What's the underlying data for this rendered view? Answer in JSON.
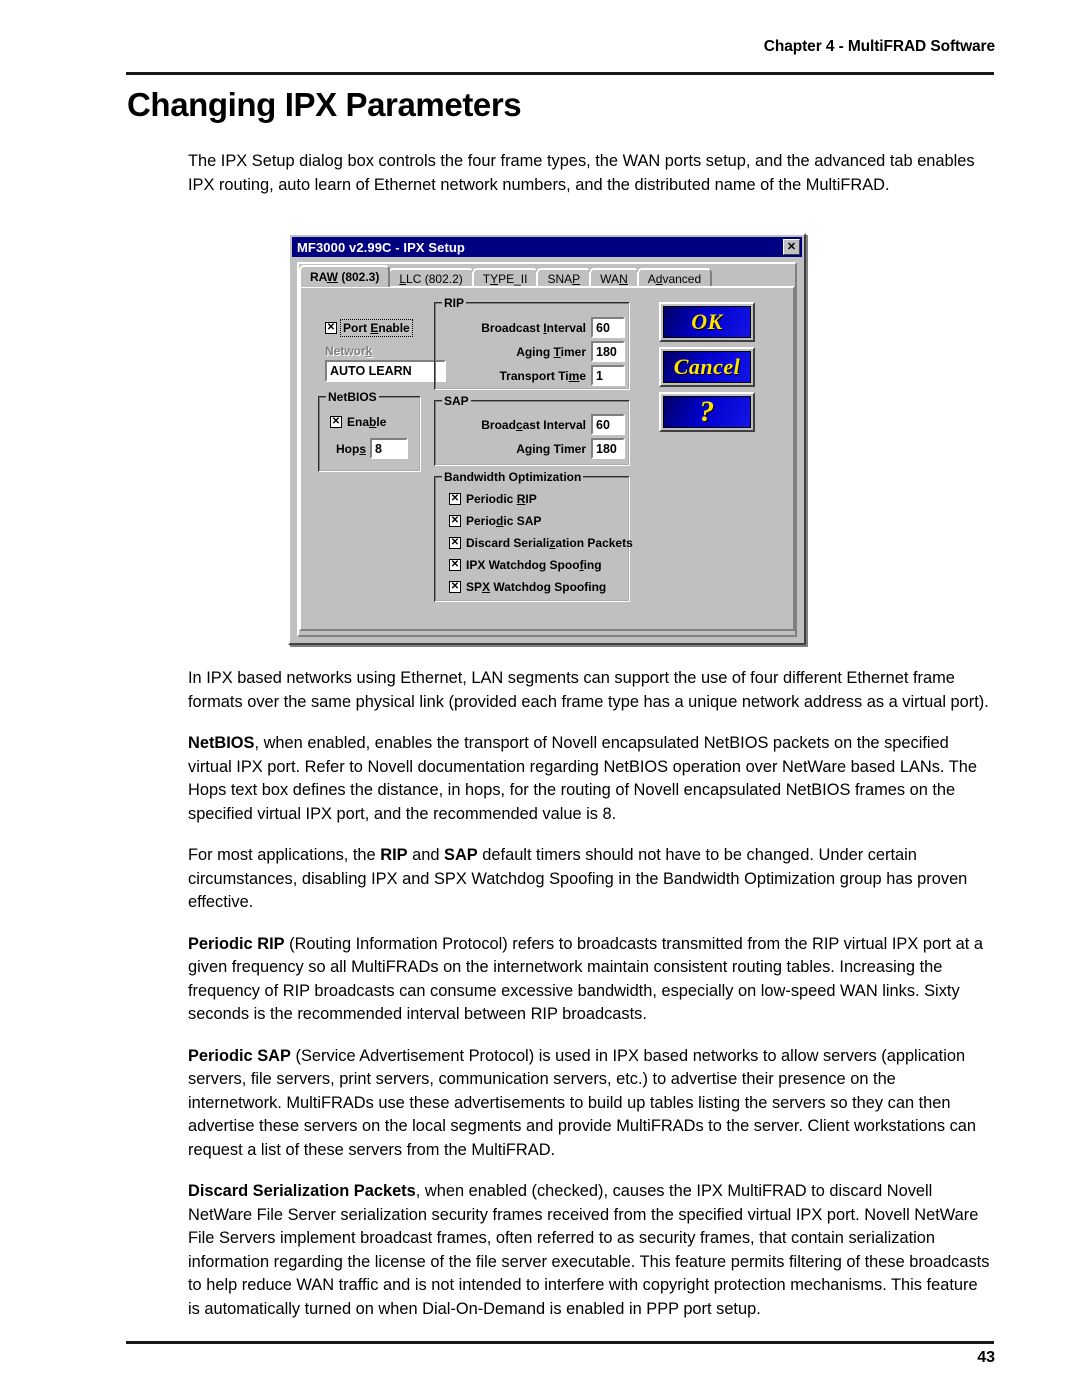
{
  "page": {
    "running_head": "Chapter 4 - MultiFRAD Software",
    "title": "Changing IPX Parameters",
    "folio": "43"
  },
  "intro": {
    "paragraph": "The IPX Setup dialog box controls the four frame types, the WAN ports setup, and the advanced tab enables IPX routing, auto learn of Ethernet network numbers, and the distributed name of the MultiFRAD."
  },
  "dialog": {
    "title": "MF3000 v2.99C - IPX Setup",
    "close_label": "✕",
    "tabs": [
      {
        "label": "RAW (802.3)",
        "pre": "RA",
        "accel": "W",
        "post": " (802.3)",
        "active": true
      },
      {
        "label": "LLC (802.2)",
        "pre": "",
        "accel": "L",
        "post": "LC (802.2)",
        "active": false
      },
      {
        "label": "TYPE_II",
        "pre": "T",
        "accel": "Y",
        "post": "PE_II",
        "active": false
      },
      {
        "label": "SNAP",
        "pre": "SNA",
        "accel": "P",
        "post": "",
        "active": false
      },
      {
        "label": "WAN",
        "pre": "WA",
        "accel": "N",
        "post": "",
        "active": false
      },
      {
        "label": "Advanced",
        "pre": "A",
        "accel": "d",
        "post": "vanced",
        "active": false
      }
    ],
    "port_enable": {
      "label_pre": "Port ",
      "accel": "E",
      "label_post": "nable",
      "checked": "X"
    },
    "network": {
      "label_pre": "Networ",
      "accel": "k",
      "label_post": "",
      "value": "AUTO LEARN"
    },
    "netbios": {
      "group_title": "NetBIOS",
      "enable": {
        "label_pre": "Ena",
        "accel": "b",
        "label_post": "le",
        "checked": "X"
      },
      "hops": {
        "label_pre": "Hop",
        "accel": "s",
        "label_post": "",
        "value": "8"
      }
    },
    "rip": {
      "group_title": "RIP",
      "rows": [
        {
          "label_pre": "Broadcast ",
          "accel": "I",
          "label_post": "nterval",
          "value": "60"
        },
        {
          "label_pre": "Aging ",
          "accel": "T",
          "label_post": "imer",
          "value": "180"
        },
        {
          "label_pre": "Transport Ti",
          "accel": "m",
          "label_post": "e",
          "value": "1"
        }
      ]
    },
    "sap": {
      "group_title": "SAP",
      "rows": [
        {
          "label_pre": "Broad",
          "accel": "c",
          "label_post": "ast Interval",
          "value": "60"
        },
        {
          "label_pre": "A",
          "accel": "g",
          "label_post": "ing Timer",
          "value": "180"
        }
      ]
    },
    "bandwidth": {
      "group_title": "Bandwidth Optimization",
      "items": [
        {
          "label_pre": "Periodic ",
          "accel": "R",
          "label_post": "IP",
          "checked": "X"
        },
        {
          "label_pre": "Perio",
          "accel": "d",
          "label_post": "ic SAP",
          "checked": "X"
        },
        {
          "label_pre": "Discard Seriali",
          "accel": "z",
          "label_post": "ation Packets",
          "checked": "X"
        },
        {
          "label_pre": "IPX Watchdog Spoo",
          "accel": "f",
          "label_post": "ing",
          "checked": "X"
        },
        {
          "label_pre": "SP",
          "accel": "X",
          "label_post": " Watchdog Spoofing",
          "checked": "X"
        }
      ]
    },
    "buttons": {
      "ok": "OK",
      "cancel": "Cancel",
      "help": "?"
    }
  },
  "body": {
    "p1": "In IPX based networks using Ethernet, LAN segments can support the use of four different Ethernet frame formats over the same physical link (provided each frame type has a unique network address as a virtual port).",
    "p2_lead": "NetBIOS",
    "p2_rest": ", when enabled, enables the transport of Novell encapsulated NetBIOS packets on the specified virtual IPX port. Refer to Novell documentation regarding NetBIOS operation over NetWare based LANs. The Hops text box defines the distance, in hops, for the routing of Novell encapsulated NetBIOS frames on the specified virtual IPX port, and the recommended value is 8.",
    "p3_a": "For most applications, the ",
    "p3_b": "RIP",
    "p3_c": " and ",
    "p3_d": "SAP",
    "p3_e": " default timers should not have to be changed. Under certain circumstances, disabling IPX and SPX Watchdog Spoofing in the Bandwidth Optimization group has proven effective.",
    "p4_lead": "Periodic RIP",
    "p4_rest": " (Routing Information Protocol) refers to broadcasts transmitted from the RIP virtual IPX port at a given frequency so all MultiFRADs on the internetwork maintain consistent routing tables. Increasing the frequency of RIP broadcasts can consume excessive bandwidth, especially on low-speed WAN links. Sixty seconds is the recommended interval between RIP broadcasts.",
    "p5_lead": "Periodic SAP",
    "p5_rest": " (Service Advertisement Protocol) is used in IPX based networks to allow servers (application servers, file servers, print servers, communication servers, etc.) to advertise their presence on the internetwork. MultiFRADs use these advertisements to build up tables listing the servers so they can then advertise these servers on the local segments and provide MultiFRADs to the server. Client workstations can request a list of these servers from the MultiFRAD.",
    "p6_lead": "Discard Serialization Packets",
    "p6_rest": ", when enabled (checked), causes the IPX MultiFRAD to discard Novell NetWare File Server serialization security frames received from the specified virtual IPX port. Novell NetWare File Servers implement broadcast frames, often referred to as security frames, that contain serialization information regarding the license of the file server executable. This feature permits filtering of these broadcasts to help reduce WAN traffic and is not intended to interfere with copyright protection mechanisms. This feature is automatically turned on when Dial-On-Demand is enabled in PPP port setup."
  }
}
